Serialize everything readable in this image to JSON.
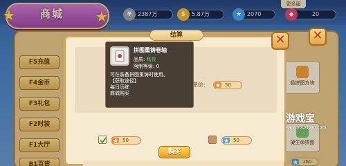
{
  "header": {
    "title": "商城",
    "top_button": "更多服"
  },
  "currencies": [
    {
      "icon": "silver-coin-icon",
      "value": "2387万",
      "color": "#9aa2ad"
    },
    {
      "icon": "gold-coin-icon",
      "value": "5.87万",
      "color": "#f0b52a"
    },
    {
      "icon": "star-ticket-icon",
      "value": "2070",
      "color": "#4aa4e8"
    },
    {
      "icon": "diamond-icon",
      "value": "20",
      "color": "#e0486a"
    }
  ],
  "sidebar": {
    "items": [
      {
        "label": "F5充值"
      },
      {
        "label": "F4金币"
      },
      {
        "label": "F3礼包"
      },
      {
        "label": "F2时装"
      },
      {
        "label": "F1大厅"
      },
      {
        "label": "B1百货"
      }
    ]
  },
  "right_items": [
    {
      "label": "极拼图方块"
    },
    {
      "label": "凝生命拼图"
    }
  ],
  "right_price": "160",
  "watermark": {
    "brand": "游戏宝",
    "url": "www.youxibao.com"
  },
  "dialog": {
    "title": "结算",
    "unit_price_label": "单价:",
    "unit_price_value": "50",
    "confirm_label": "购买",
    "price_left": "50",
    "price_right": "50"
  },
  "tooltip": {
    "title": "拼图重铸卷轴",
    "quality_label": "品质:",
    "quality_value": "精良",
    "level_label": "限制等级:",
    "level_value": "0",
    "desc_lines": [
      "可在装备拼图重铸时使用。",
      "【获取途径】",
      "每日历练",
      "商城购买"
    ]
  },
  "colors": {
    "accent": "#cfa560",
    "quality_text": "#4fd36a",
    "confirm": "#ec9f1e"
  }
}
